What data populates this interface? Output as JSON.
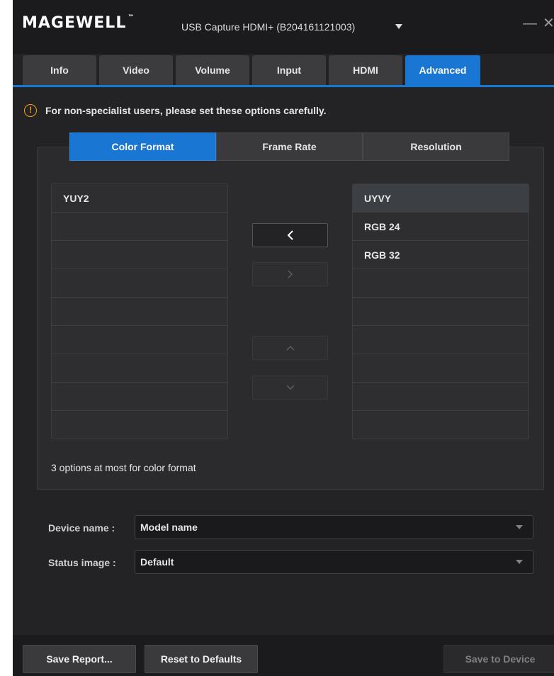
{
  "titlebar": {
    "logo": "MAGEWELL",
    "logo_tm": "™",
    "device": "USB Capture HDMI+ (B204161121003)",
    "minimize_glyph": "—",
    "close_glyph": "✕"
  },
  "tabs": [
    {
      "label": "Info",
      "active": false
    },
    {
      "label": "Video",
      "active": false
    },
    {
      "label": "Volume",
      "active": false
    },
    {
      "label": "Input",
      "active": false
    },
    {
      "label": "HDMI",
      "active": false
    },
    {
      "label": "Advanced",
      "active": true
    }
  ],
  "warning": {
    "icon_glyph": "!",
    "text": "For non-specialist users, please set these options carefully."
  },
  "subtabs": [
    {
      "label": "Color Format",
      "active": true
    },
    {
      "label": "Frame Rate",
      "active": false
    },
    {
      "label": "Resolution",
      "active": false
    }
  ],
  "left_list": {
    "items": [
      "YUY2",
      "",
      "",
      "",
      "",
      "",
      "",
      "",
      ""
    ]
  },
  "right_list": {
    "items": [
      "UYVY",
      "RGB 24",
      "RGB 32",
      "",
      "",
      "",
      "",
      "",
      ""
    ],
    "selected_index": 0
  },
  "controls": {
    "move_left": {
      "icon": "chevron-left-icon",
      "enabled": true
    },
    "move_right": {
      "icon": "chevron-right-icon",
      "enabled": false
    },
    "move_up": {
      "icon": "chevron-up-icon",
      "enabled": false
    },
    "move_down": {
      "icon": "chevron-down-icon",
      "enabled": false
    }
  },
  "hint": "3 options at most for color format",
  "form": {
    "device_name_label": "Device name :",
    "device_name_value": "Model name",
    "status_image_label": "Status image :",
    "status_image_value": "Default"
  },
  "buttons": {
    "save_report": "Save Report...",
    "reset_defaults": "Reset to Defaults",
    "save_device": "Save to Device"
  },
  "colors": {
    "accent": "#1976d2",
    "background": "#232325",
    "warning": "#f0a020"
  }
}
